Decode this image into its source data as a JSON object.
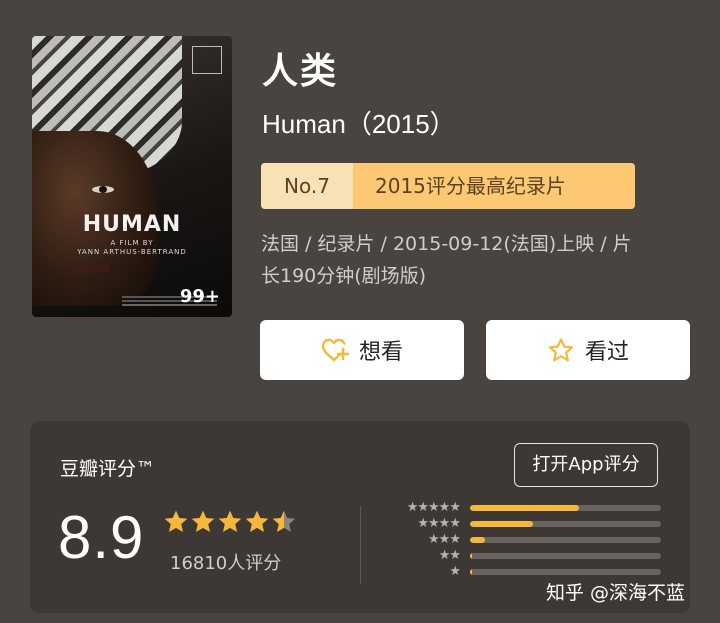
{
  "poster": {
    "film_title": "HUMAN",
    "byline": "A FILM BY",
    "director": "YANN ARTHUS-BERTRAND",
    "badge_count": "99+"
  },
  "movie": {
    "title": "人类",
    "original_title": "Human（2015）",
    "rank_number": "No.7",
    "rank_text": "2015评分最高纪录片",
    "meta_line1": "法国 / 纪录片 / 2015-09-12(法国)上映 / 片",
    "meta_line2": "长190分钟(剧场版)"
  },
  "actions": {
    "want_label": "想看",
    "seen_label": "看过"
  },
  "rating": {
    "label": "豆瓣评分™",
    "open_app_label": "打开App评分",
    "score": "8.9",
    "stars_value": 4.5,
    "votes": "16810人评分",
    "distribution": [
      {
        "stars": "★★★★★",
        "fraction": 0.57
      },
      {
        "stars": "★★★★",
        "fraction": 0.33
      },
      {
        "stars": "★★★",
        "fraction": 0.08
      },
      {
        "stars": "★★",
        "fraction": 0.01
      },
      {
        "stars": "★",
        "fraction": 0.01
      }
    ]
  },
  "watermark": "知乎 @深海不蓝",
  "colors": {
    "background": "#4a4441",
    "card": "#3e3835",
    "star": "#f6b83a",
    "rank_bg": "#fcc873",
    "rank_no_bg": "#f7e2b5"
  }
}
